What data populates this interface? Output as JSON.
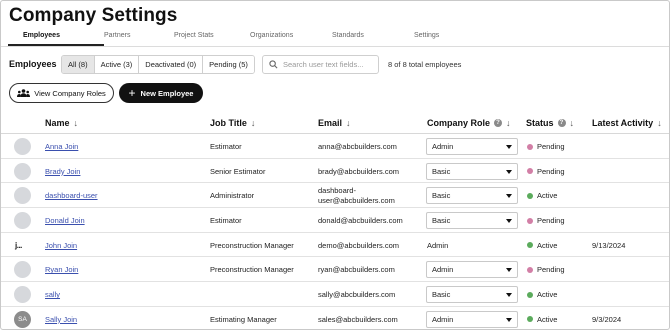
{
  "page": {
    "title": "Company Settings"
  },
  "tabs": [
    {
      "label": "Employees",
      "active": true
    },
    {
      "label": "Partners",
      "active": false
    },
    {
      "label": "Project Stats",
      "active": false
    },
    {
      "label": "Organizations",
      "active": false
    },
    {
      "label": "Standards",
      "active": false
    },
    {
      "label": "Settings",
      "active": false
    }
  ],
  "filter": {
    "label": "Employees",
    "segments": [
      {
        "label": "All (8)",
        "selected": true
      },
      {
        "label": "Active (3)",
        "selected": false
      },
      {
        "label": "Deactivated (0)",
        "selected": false
      },
      {
        "label": "Pending (5)",
        "selected": false
      }
    ],
    "search_placeholder": "Search user text fields...",
    "total_text": "8 of 8 total employees"
  },
  "actions": {
    "view_roles_label": "View Company Roles",
    "new_employee_label": "New Employee"
  },
  "table": {
    "headers": {
      "name": "Name",
      "job_title": "Job Title",
      "email": "Email",
      "company_role": "Company Role",
      "status": "Status",
      "latest_activity": "Latest Activity"
    },
    "sort_arrow": "↓",
    "help_glyph": "?",
    "rows": [
      {
        "avatar": "",
        "avatar_type": "blank",
        "name": "Anna Join",
        "job_title": "Estimator",
        "email": [
          "anna@abcbuilders.com"
        ],
        "role": "Admin",
        "role_is_select": true,
        "status": "Pending",
        "latest_activity": ""
      },
      {
        "avatar": "",
        "avatar_type": "blank",
        "name": "Brady Join",
        "job_title": "Senior Estimator",
        "email": [
          "brady@abcbuilders.com"
        ],
        "role": "Basic",
        "role_is_select": true,
        "status": "Pending",
        "latest_activity": ""
      },
      {
        "avatar": "",
        "avatar_type": "blank",
        "name": "dashboard-user",
        "job_title": "Administrator",
        "email": [
          "dashboard-",
          "user@abcbuilders.com"
        ],
        "role": "Basic",
        "role_is_select": true,
        "status": "Active",
        "latest_activity": ""
      },
      {
        "avatar": "",
        "avatar_type": "blank",
        "name": "Donald Join",
        "job_title": "Estimator",
        "email": [
          "donald@abcbuilders.com"
        ],
        "role": "Basic",
        "role_is_select": true,
        "status": "Pending",
        "latest_activity": ""
      },
      {
        "avatar": "j...",
        "avatar_type": "logo",
        "name": "John Join",
        "job_title": "Preconstruction Manager",
        "email": [
          "demo@abcbuilders.com"
        ],
        "role": "Admin",
        "role_is_select": false,
        "status": "Active",
        "latest_activity": "9/13/2024"
      },
      {
        "avatar": "",
        "avatar_type": "blank",
        "name": "Ryan Join",
        "job_title": "Preconstruction Manager",
        "email": [
          "ryan@abcbuilders.com"
        ],
        "role": "Admin",
        "role_is_select": true,
        "status": "Pending",
        "latest_activity": ""
      },
      {
        "avatar": "",
        "avatar_type": "blank",
        "name": "sally",
        "job_title": "",
        "email": [
          "sally@abcbuilders.com"
        ],
        "role": "Basic",
        "role_is_select": true,
        "status": "Active",
        "latest_activity": ""
      },
      {
        "avatar": "SA",
        "avatar_type": "initials",
        "name": "Sally Join",
        "job_title": "Estimating Manager",
        "email": [
          "sales@abcbuilders.com"
        ],
        "role": "Admin",
        "role_is_select": true,
        "status": "Active",
        "latest_activity": "9/3/2024"
      }
    ]
  },
  "colors": {
    "status_pending": "#d27fa6",
    "status_active": "#5bab5c",
    "link": "#3a4fae"
  },
  "icons": {
    "search": "search-icon",
    "people": "people-icon",
    "plus": "plus-icon",
    "caret": "chevron-down-icon",
    "help": "help-icon"
  }
}
